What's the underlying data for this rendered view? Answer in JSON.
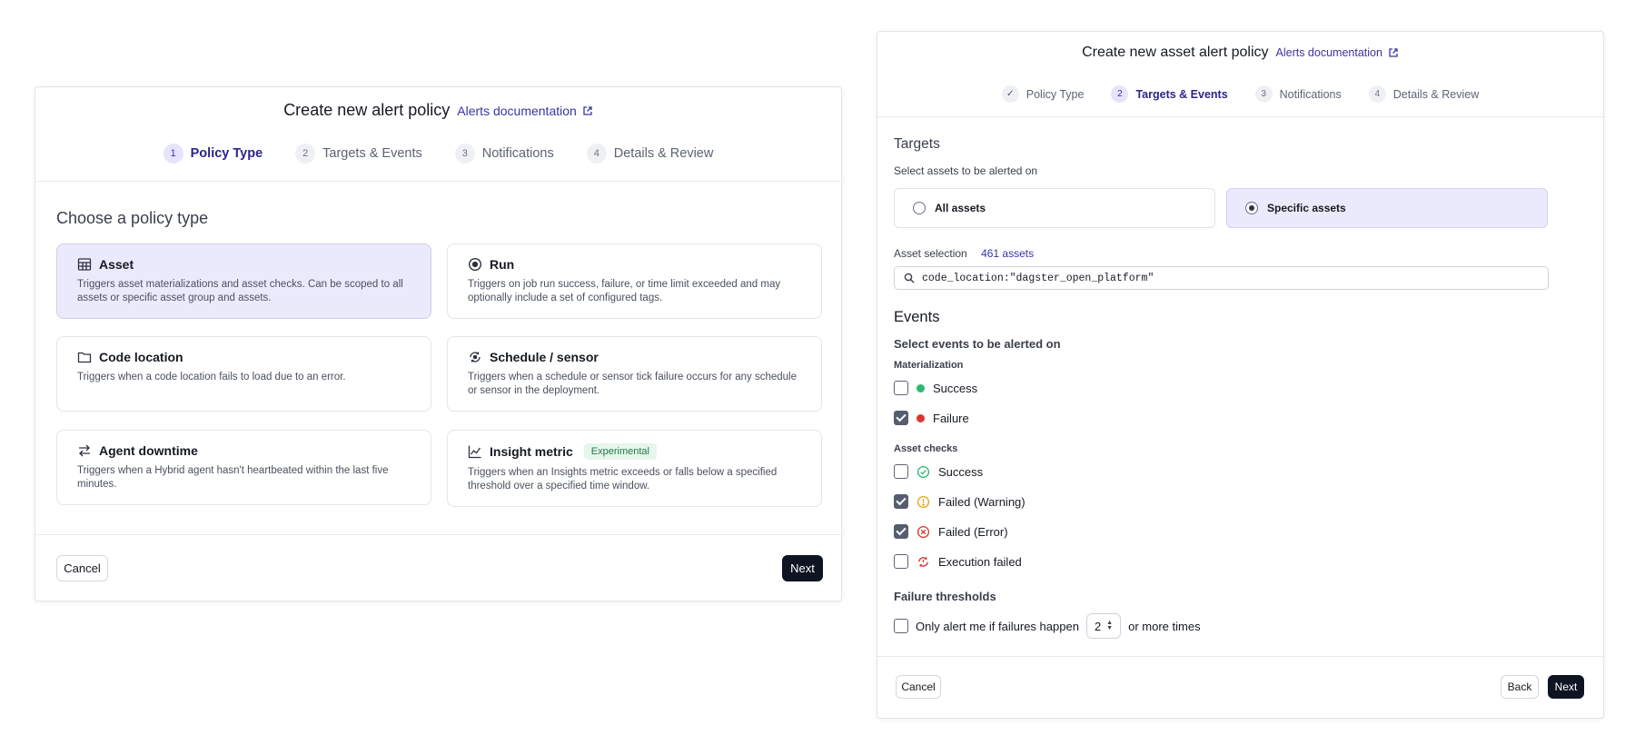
{
  "left": {
    "title": "Create new alert policy",
    "doc_link": "Alerts documentation",
    "steps": [
      {
        "num": "1",
        "label": "Policy Type"
      },
      {
        "num": "2",
        "label": "Targets & Events"
      },
      {
        "num": "3",
        "label": "Notifications"
      },
      {
        "num": "4",
        "label": "Details & Review"
      }
    ],
    "heading": "Choose a policy type",
    "cards": [
      {
        "title": "Asset",
        "icon": "table-icon",
        "desc": "Triggers asset materializations and asset checks. Can be scoped to all assets or specific asset group and assets."
      },
      {
        "title": "Run",
        "icon": "run-icon",
        "desc": "Triggers on job run success, failure, or time limit exceeded and may optionally include a set of configured tags."
      },
      {
        "title": "Code location",
        "icon": "folder-icon",
        "desc": "Triggers when a code location fails to load due to an error."
      },
      {
        "title": "Schedule / sensor",
        "icon": "sensor-icon",
        "desc": "Triggers when a schedule or sensor tick failure occurs for any schedule or sensor in the deployment."
      },
      {
        "title": "Agent downtime",
        "icon": "swap-arrows-icon",
        "desc": "Triggers when a Hybrid agent hasn't heartbeated within the last five minutes."
      },
      {
        "title": "Insight metric",
        "icon": "chart-icon",
        "badge": "Experimental",
        "desc": "Triggers when an Insights metric exceeds or falls below a specified threshold over a specified time window."
      }
    ],
    "cancel": "Cancel",
    "next": "Next"
  },
  "right": {
    "title": "Create new asset alert policy",
    "doc_link": "Alerts documentation",
    "steps": [
      {
        "num": "✓",
        "label": "Policy Type"
      },
      {
        "num": "2",
        "label": "Targets & Events"
      },
      {
        "num": "3",
        "label": "Notifications"
      },
      {
        "num": "4",
        "label": "Details & Review"
      }
    ],
    "targets_heading": "Targets",
    "targets_sub": "Select assets to be alerted on",
    "all_assets": "All assets",
    "specific_assets": "Specific assets",
    "asset_selection_label": "Asset selection",
    "asset_count": "461 assets",
    "asset_query": "code_location:\"dagster_open_platform\"",
    "events_heading": "Events",
    "events_sub": "Select events to be alerted on",
    "materialization_label": "Materialization",
    "materialization": [
      {
        "label": "Success",
        "checked": false,
        "color": "#2eb872"
      },
      {
        "label": "Failure",
        "checked": true,
        "color": "#d8382f"
      }
    ],
    "asset_checks_label": "Asset checks",
    "asset_checks": [
      {
        "label": "Success",
        "checked": false
      },
      {
        "label": "Failed (Warning)",
        "checked": true
      },
      {
        "label": "Failed (Error)",
        "checked": true
      },
      {
        "label": "Execution failed",
        "checked": false
      }
    ],
    "failure_thresholds_heading": "Failure thresholds",
    "threshold_prefix": "Only alert me if failures happen",
    "threshold_value": "2",
    "threshold_suffix": "or more times",
    "cancel": "Cancel",
    "back": "Back",
    "next": "Next"
  }
}
